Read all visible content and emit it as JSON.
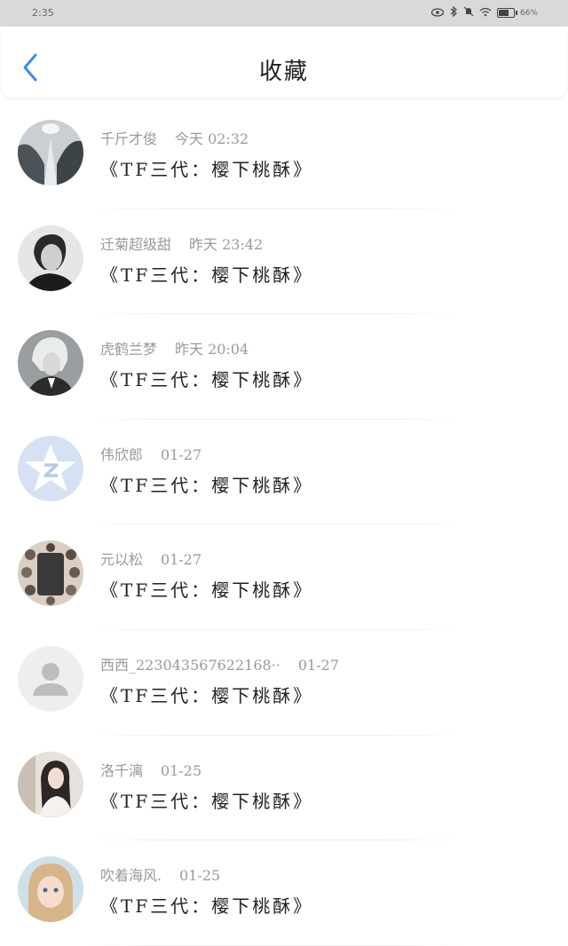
{
  "status_bar": {
    "time": "2:35",
    "battery": "66%",
    "battery_level": 0.66,
    "icons": [
      "eye-icon",
      "bluetooth-icon",
      "mute-icon",
      "wifi-icon",
      "battery-icon"
    ]
  },
  "header": {
    "title": "收藏",
    "back_icon": "chevron-left-icon"
  },
  "colors": {
    "accent": "#3a8ee6",
    "meta_text": "#9a9a9a",
    "content_text": "#222222",
    "status_bar_bg": "#d9d9d9"
  },
  "items": [
    {
      "user": "千斤才俊",
      "time": "今天 02:32",
      "content": "《TF三代：樱下桃酥》",
      "avatar": "snowy-forest-avatar"
    },
    {
      "user": "迁菊超级甜",
      "time": "昨天 23:42",
      "content": "《TF三代：樱下桃酥》",
      "avatar": "man-portrait-avatar"
    },
    {
      "user": "虎鹤兰梦",
      "time": "昨天 20:04",
      "content": "《TF三代：樱下桃酥》",
      "avatar": "white-hair-character-avatar"
    },
    {
      "user": "伟欣郎",
      "time": "01-27",
      "content": "《TF三代：樱下桃酥》",
      "avatar": "qzone-star-avatar"
    },
    {
      "user": "元以松",
      "time": "01-27",
      "content": "《TF三代：樱下桃酥》",
      "avatar": "group-collage-avatar"
    },
    {
      "user": "西西_223043567622168··",
      "time": "01-27",
      "content": "《TF三代：樱下桃酥》",
      "avatar": "default-user-avatar"
    },
    {
      "user": "洛千漓",
      "time": "01-25",
      "content": "《TF三代：樱下桃酥》",
      "avatar": "girl-portrait-avatar"
    },
    {
      "user": "吹着海风.",
      "time": "01-25",
      "content": "《TF三代：樱下桃酥》",
      "avatar": "cartoon-girl-avatar"
    }
  ]
}
